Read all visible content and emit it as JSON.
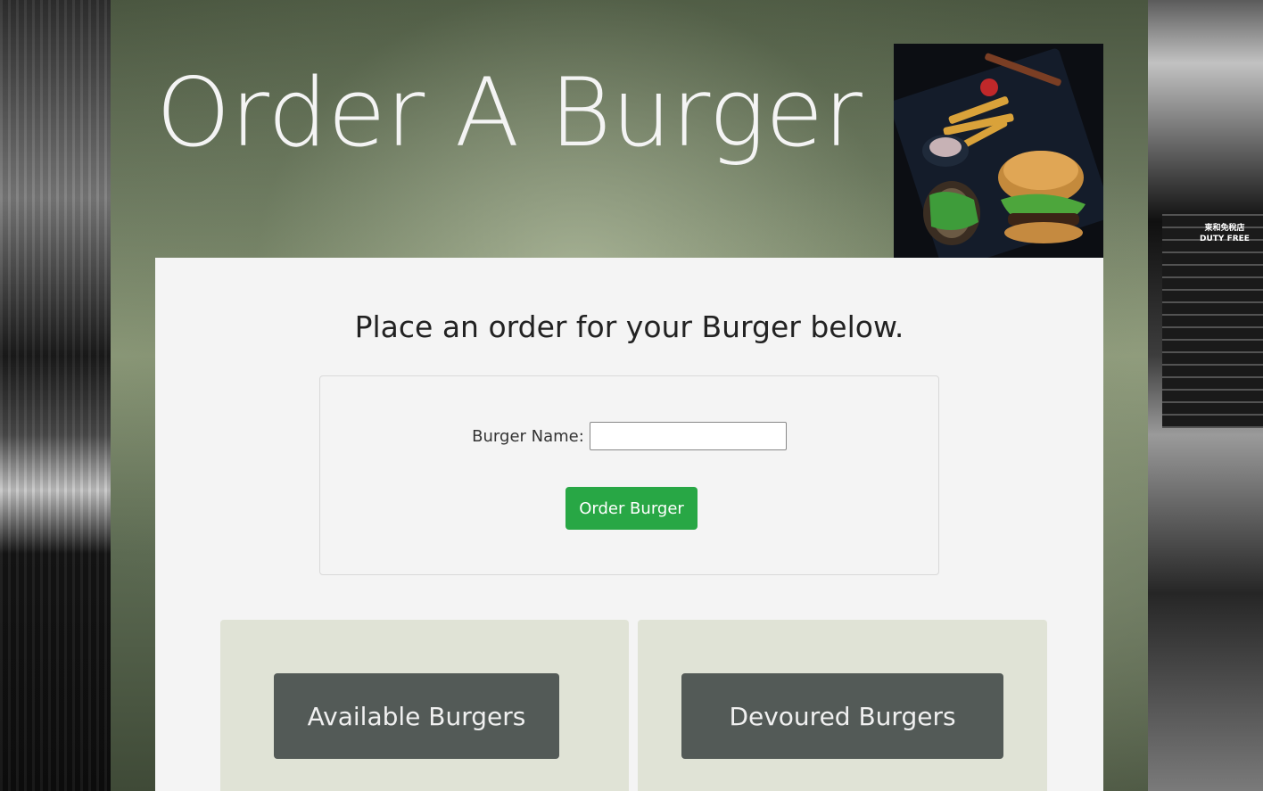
{
  "hero": {
    "title": "Order A Burger"
  },
  "order_form": {
    "subtitle": "Place an order for your Burger below.",
    "burger_name_label": "Burger Name:",
    "burger_name_value": "",
    "burger_name_placeholder": "",
    "submit_label": "Order Burger"
  },
  "panels": {
    "available_title": "Available Burgers",
    "devoured_title": "Devoured Burgers"
  },
  "background": {
    "sign_text_line1": "東和免稅店",
    "sign_text_line2": "DUTY FREE"
  },
  "colors": {
    "button_green": "#28a745",
    "panel_bg": "#e0e3d6",
    "panel_header_bg": "#535a57",
    "card_bg": "#f4f4f4"
  }
}
